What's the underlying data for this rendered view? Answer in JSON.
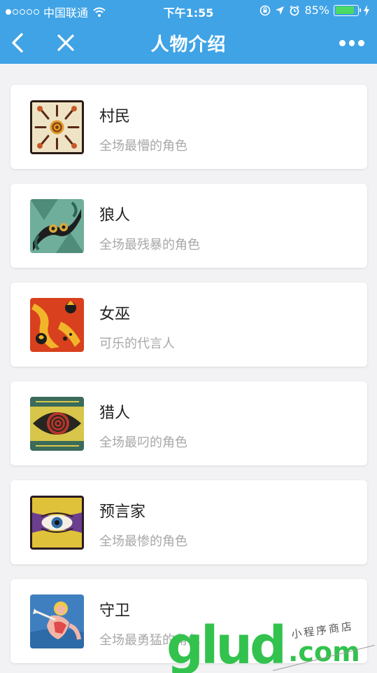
{
  "status_bar": {
    "carrier": "中国联通",
    "time": "下午1:55",
    "battery_percent": "85%",
    "battery_level": 0.85,
    "colors": {
      "background": "#3fa3e6",
      "battery_fill": "#4cd964"
    }
  },
  "nav": {
    "title": "人物介绍",
    "back_icon": "chevron-left-icon",
    "close_icon": "close-icon",
    "more_icon": "more-dots-icon",
    "colors": {
      "background": "#3fa3e6",
      "text": "#ffffff"
    }
  },
  "roles": [
    {
      "name": "村民",
      "description": "全场最懵的角色",
      "icon": "villager-card-image"
    },
    {
      "name": "狼人",
      "description": "全场最残暴的角色",
      "icon": "werewolf-card-image"
    },
    {
      "name": "女巫",
      "description": "可乐的代言人",
      "icon": "witch-card-image"
    },
    {
      "name": "猎人",
      "description": "全场最叼的角色",
      "icon": "hunter-card-image"
    },
    {
      "name": "预言家",
      "description": "全场最惨的角色",
      "icon": "seer-card-image"
    },
    {
      "name": "守卫",
      "description": "全场最勇猛的角色",
      "icon": "guard-card-image"
    }
  ],
  "watermark": {
    "brand": "glud",
    "suffix": ".com",
    "tagline": "小程序商店",
    "color": "#33c24d"
  },
  "colors": {
    "page_background": "#f2f2f4",
    "title_text": "#222222",
    "subtitle_text": "#a8a8a8"
  }
}
